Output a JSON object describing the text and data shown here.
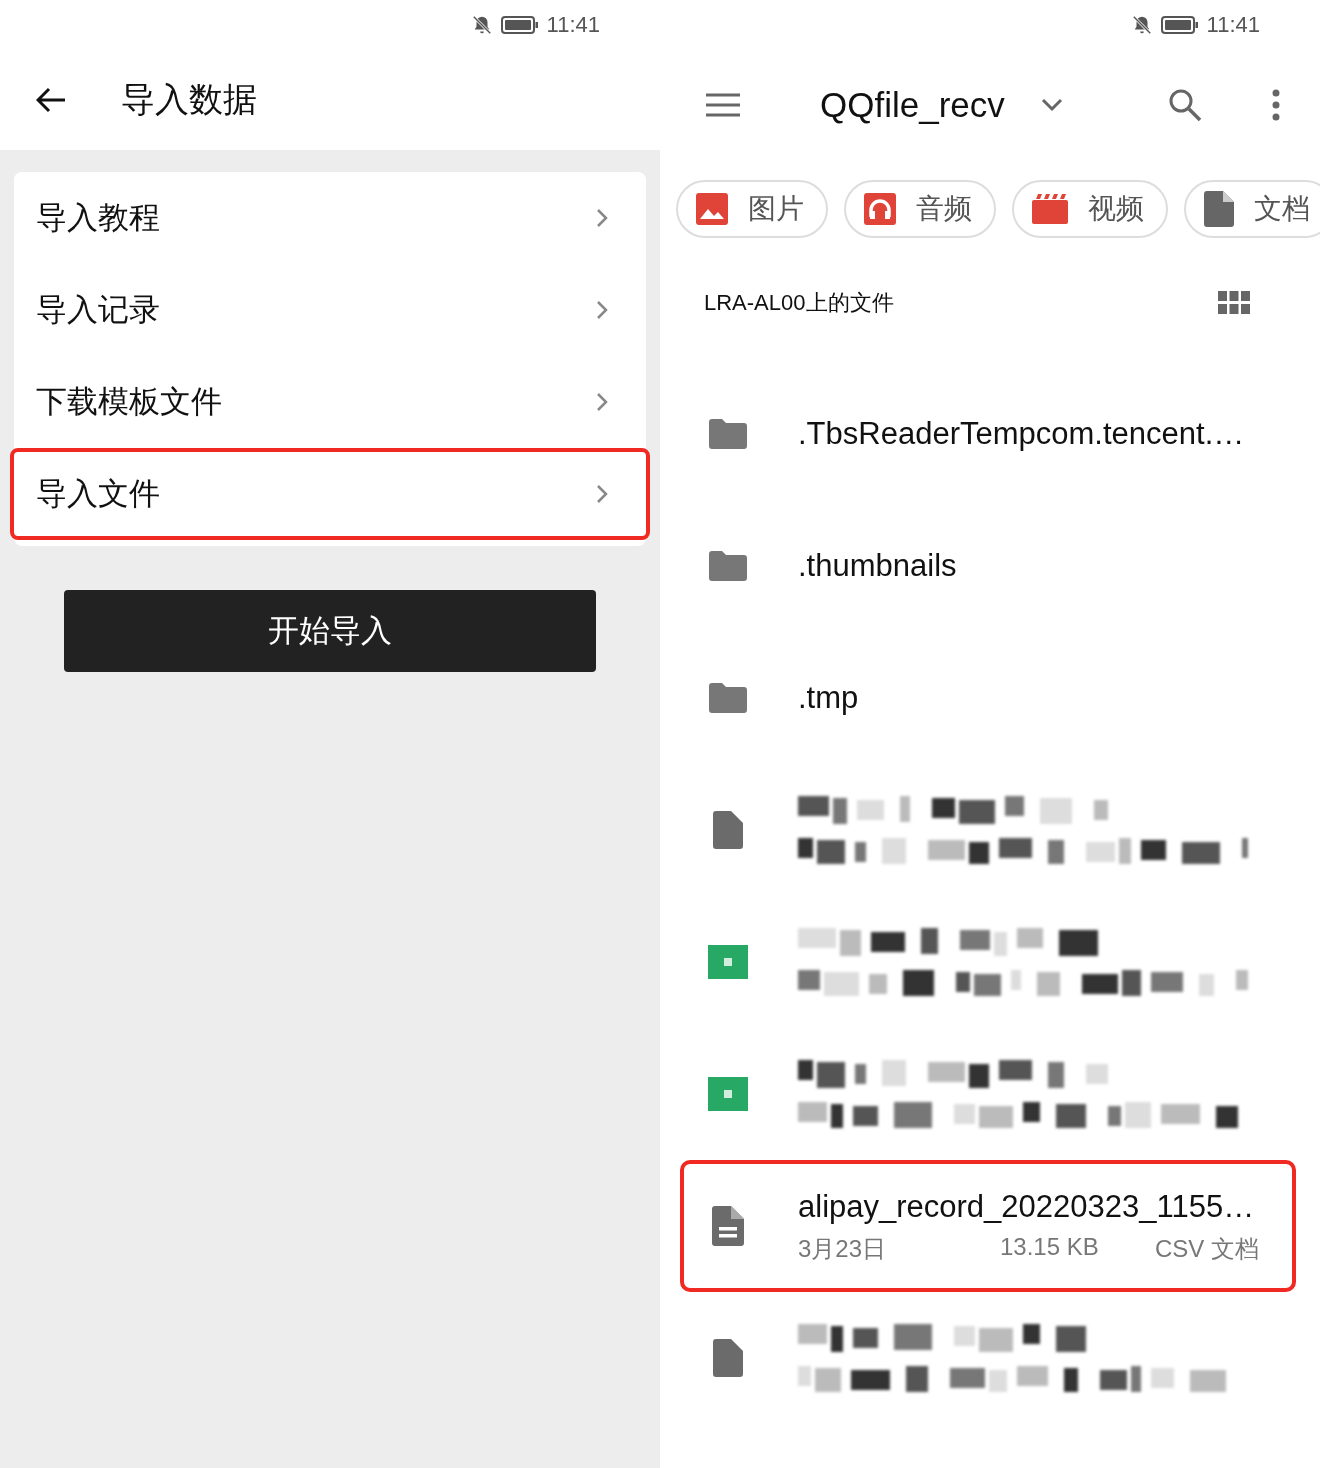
{
  "left": {
    "status_bar": {
      "time": "11:41"
    },
    "title": "导入数据",
    "menu": [
      {
        "label": "导入教程",
        "highlighted": false
      },
      {
        "label": "导入记录",
        "highlighted": false
      },
      {
        "label": "下载模板文件",
        "highlighted": false
      },
      {
        "label": "导入文件",
        "highlighted": true
      }
    ],
    "start_button": "开始导入"
  },
  "right": {
    "status_bar": {
      "time": "11:41"
    },
    "folder": "QQfile_recv",
    "categories": [
      {
        "kind": "image",
        "label": "图片"
      },
      {
        "kind": "audio",
        "label": "音频"
      },
      {
        "kind": "video",
        "label": "视频"
      },
      {
        "kind": "document",
        "label": "文档"
      }
    ],
    "location": "LRA-AL00上的文件",
    "files": [
      {
        "kind": "folder",
        "name": ".TbsReaderTempcom.tencent.…",
        "highlighted": false
      },
      {
        "kind": "folder",
        "name": ".thumbnails",
        "highlighted": false
      },
      {
        "kind": "folder",
        "name": ".tmp",
        "highlighted": false
      },
      {
        "kind": "redacted_file",
        "highlighted": false
      },
      {
        "kind": "redacted_sheet",
        "highlighted": false
      },
      {
        "kind": "redacted_sheet",
        "highlighted": false
      },
      {
        "kind": "file",
        "name": "alipay_record_20220323_1155…",
        "date": "3月23日",
        "size": "13.15 KB",
        "type": "CSV 文档",
        "highlighted": true
      },
      {
        "kind": "redacted_file",
        "highlighted": false
      }
    ]
  }
}
